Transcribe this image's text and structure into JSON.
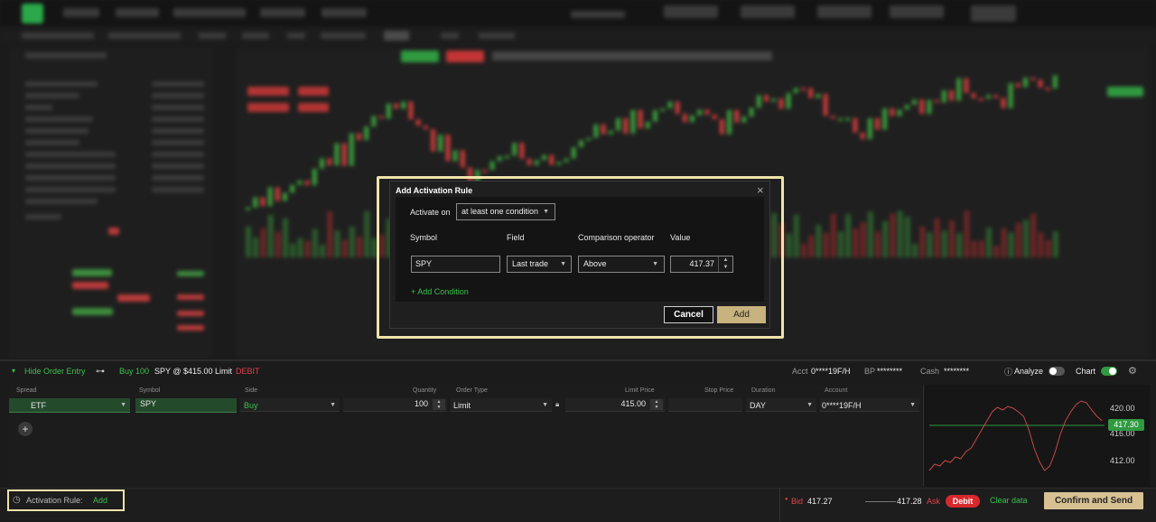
{
  "modal": {
    "title": "Add Activation Rule",
    "activate_on_label": "Activate on",
    "activate_on_value": "at least one condition",
    "columns": {
      "symbol": "Symbol",
      "field": "Field",
      "operator": "Comparison operator",
      "value": "Value"
    },
    "condition": {
      "symbol": "SPY",
      "field": "Last trade",
      "operator": "Above",
      "value": "417.37"
    },
    "add_condition": "+ Add Condition",
    "cancel": "Cancel",
    "add": "Add"
  },
  "order_header": {
    "hide_label": "Hide Order Entry",
    "summary_prefix": "Buy 100",
    "summary_main": "SPY @ $415.00 Limit",
    "summary_suffix": "DEBIT",
    "acct_label": "Acct",
    "acct_value": "0****19F/H",
    "bp_label": "BP",
    "bp_value": "********",
    "cash_label": "Cash",
    "cash_value": "********",
    "analyze_label": "Analyze",
    "chart_label": "Chart"
  },
  "order_columns": {
    "spread": "Spread",
    "symbol": "Symbol",
    "side": "Side",
    "quantity": "Quantity",
    "order_type": "Order Type",
    "limit_price": "Limit Price",
    "stop_price": "Stop Price",
    "duration": "Duration",
    "account": "Account"
  },
  "order_row": {
    "spread": "ETF",
    "symbol": "SPY",
    "side": "Buy",
    "quantity": "100",
    "order_type": "Limit",
    "limit_price": "415.00",
    "duration": "DAY",
    "account": "0****19F/H"
  },
  "mini_chart": {
    "price_labels": [
      "420.00",
      "416.00",
      "412.00"
    ],
    "current_price": "417.30"
  },
  "bottom": {
    "activation_label": "Activation Rule:",
    "activation_add": "Add",
    "bid_label": "Bid",
    "bid_value": "417.27",
    "ask_value": "417.28",
    "ask_label": "Ask",
    "debit": "Debit",
    "clear_data": "Clear data",
    "confirm": "Confirm and Send"
  },
  "colors": {
    "accent_gold": "#c8b27d",
    "highlight": "#f0e3a9",
    "green": "#39c24b",
    "red": "#e0414b"
  }
}
